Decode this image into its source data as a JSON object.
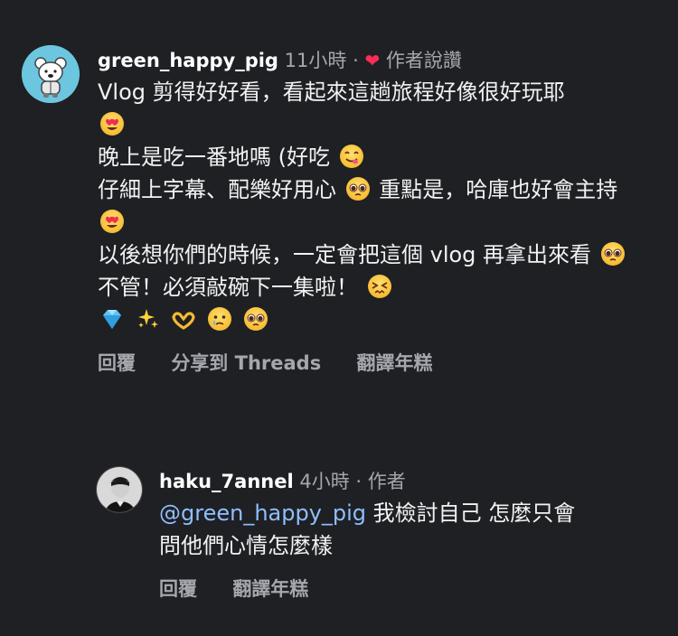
{
  "comment1": {
    "username": "green_happy_pig",
    "time": "11小時",
    "separator": "·",
    "author_liked": "作者說讚",
    "lines": [
      "Vlog 剪得好好看，看起來這趟旅程好像很好玩耶",
      "晚上是吃一番地嗎 (好吃",
      "仔細上字幕、配樂好用心",
      "重點是，哈庫也好會主持",
      "以後想你們的時候，一定會把這個 vlog 再拿出來看",
      "不管！必須敲碗下一集啦！"
    ],
    "emoji_line": [
      "gem",
      "sparkles",
      "heart-hands",
      "sad-tear",
      "pleading"
    ],
    "actions": {
      "reply": "回覆",
      "share": "分享到 Threads",
      "translate": "翻譯年糕"
    }
  },
  "comment2": {
    "username": "haku_7annel",
    "time": "4小時",
    "separator": "·",
    "author_tag": "作者",
    "mention": "@green_happy_pig",
    "text_line1": " 我檢討自己  怎麼只會",
    "text_line2": "問他們心情怎麼樣",
    "actions": {
      "reply": "回覆",
      "translate": "翻譯年糕"
    }
  },
  "colors": {
    "background": "#1f2024",
    "muted": "#a4a7ad",
    "heart": "#ff2d55",
    "mention": "#8fbfff"
  }
}
